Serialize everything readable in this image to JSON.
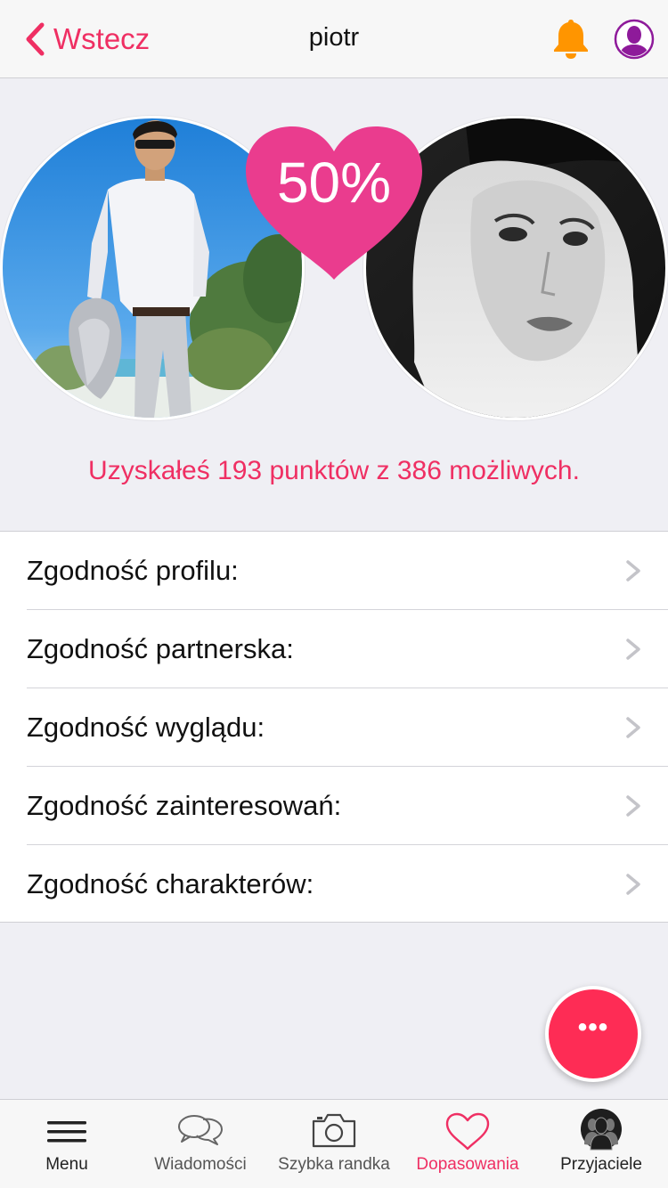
{
  "header": {
    "back_label": "Wstecz",
    "title": "piotr"
  },
  "match": {
    "percent": "50%",
    "score_text": "Uzyskałeś 193 punktów z 386 możliwych."
  },
  "compatibility": [
    {
      "label": "Zgodność profilu:"
    },
    {
      "label": "Zgodność partnerska:"
    },
    {
      "label": "Zgodność wyglądu:"
    },
    {
      "label": "Zgodność zainteresowań:"
    },
    {
      "label": "Zgodność charakterów:"
    }
  ],
  "fab": {
    "label": "•••"
  },
  "tabs": [
    {
      "label": "Menu",
      "icon": "menu-icon"
    },
    {
      "label": "Wiadomości",
      "icon": "messages-icon"
    },
    {
      "label": "Szybka randka",
      "icon": "camera-icon"
    },
    {
      "label": "Dopasowania",
      "icon": "heart-icon",
      "active": true
    },
    {
      "label": "Przyjaciele",
      "icon": "friends-icon"
    }
  ],
  "colors": {
    "accent": "#ef2f63",
    "heart": "#ea3c8e",
    "bell": "#ff9500",
    "avatar": "#8e1a9a",
    "fab": "#fe2c55"
  }
}
